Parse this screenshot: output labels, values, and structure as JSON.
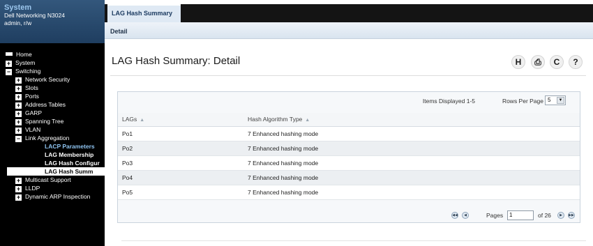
{
  "system": {
    "title": "System",
    "device": "Dell Networking N3024",
    "user": "admin, r/w"
  },
  "nav": {
    "home": "Home",
    "system": "System",
    "switching": "Switching",
    "network_security": "Network Security",
    "slots": "Slots",
    "ports": "Ports",
    "address_tables": "Address Tables",
    "garp": "GARP",
    "spanning_tree": "Spanning Tree",
    "vlan": "VLAN",
    "link_aggregation": "Link Aggregation",
    "lacp_parameters": "LACP Parameters",
    "lag_membership": "LAG Membership",
    "lag_hash_configuration": "LAG Hash Configur",
    "lag_hash_summary": "LAG Hash Summ",
    "multicast_support": "Multicast Support",
    "lldp": "LLDP",
    "dynamic_arp_inspection": "Dynamic ARP Inspection"
  },
  "tabs": {
    "main_tab": "LAG Hash Summary",
    "sub_tab": "Detail"
  },
  "page": {
    "title": "LAG Hash Summary: Detail"
  },
  "toolbar": {
    "help": "H",
    "print": "⎙",
    "refresh": "C",
    "question": "?"
  },
  "grid": {
    "items_displayed": "Items Displayed 1-5",
    "rows_per_page_label": "Rows Per Page",
    "rows_per_page_value": "5",
    "columns": [
      "LAGs",
      "Hash Algorithm Type"
    ],
    "rows": [
      {
        "lag": "Po1",
        "hash": "7 Enhanced hashing mode"
      },
      {
        "lag": "Po2",
        "hash": "7 Enhanced hashing mode"
      },
      {
        "lag": "Po3",
        "hash": "7 Enhanced hashing mode"
      },
      {
        "lag": "Po4",
        "hash": "7 Enhanced hashing mode"
      },
      {
        "lag": "Po5",
        "hash": "7 Enhanced hashing mode"
      }
    ]
  },
  "pager": {
    "pages_label": "Pages",
    "current_page": "1",
    "of_total": "of 26"
  },
  "colors": {
    "sidebar_bg": "#000000",
    "header_bg": "#33577c",
    "accent_text": "#8ec3f0",
    "tab_bar_bg": "#141414",
    "row_alt": "#eceff2"
  }
}
